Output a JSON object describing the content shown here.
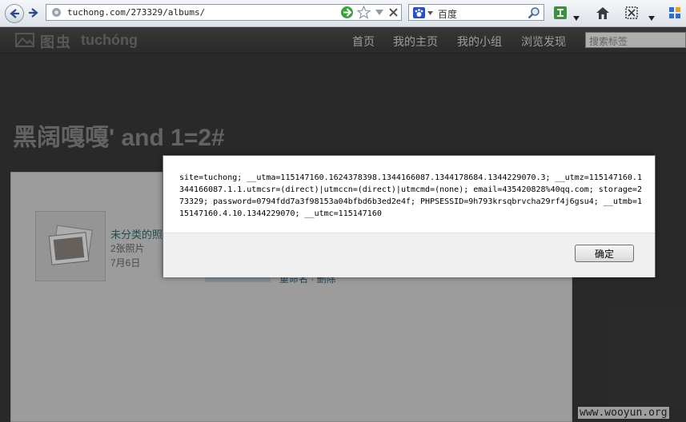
{
  "browser": {
    "url": "tuchong.com/273329/albums/",
    "search_engine": "百度"
  },
  "site": {
    "logo_cn": "图虫",
    "logo_en": "tuchóng",
    "nav": [
      {
        "label": "首页"
      },
      {
        "label": "我的主页"
      },
      {
        "label": "我的小组"
      },
      {
        "label": "浏览发现"
      }
    ],
    "search_placeholder": "搜索标签"
  },
  "page": {
    "title": "黑阔嘎嘎' and 1=2#",
    "album": {
      "name": "未分类的照片",
      "count": "2张照片",
      "date": "7月6日",
      "actions": "重命名 · 删除"
    }
  },
  "dialog": {
    "message": "site=tuchong; __utma=115147160.1624378398.1344166087.1344178684.1344229070.3; __utmz=115147160.1344166087.1.1.utmcsr=(direct)|utmccn=(direct)|utmcmd=(none); email=435420828%40qq.com; storage=273329; password=0794fdd7a3f98153a04bfbd6b3ed2e4f; PHPSESSID=9h793krsqbrvcha29rf4j6gsu4; __utmb=115147160.4.10.1344229070; __utmc=115147160",
    "ok_label": "确定"
  },
  "watermark": "www.wooyun.org",
  "colors": {
    "header_bg": "#424242",
    "page_bg": "#3a3a3a",
    "dialog_bg": "#ffffff",
    "dialog_footer_bg": "#f0f0f0"
  }
}
